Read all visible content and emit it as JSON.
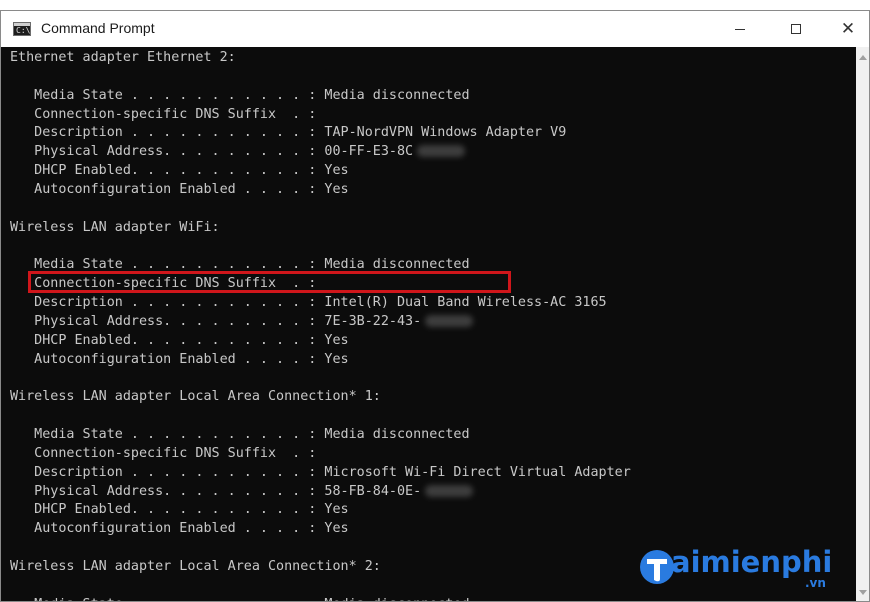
{
  "window": {
    "title": "Command Prompt",
    "icon": "cmd-icon",
    "icon_glyph": "C:\\",
    "controls": {
      "minimize": "minimize-icon",
      "maximize": "maximize-icon",
      "close": "close-icon",
      "close_glyph": "✕"
    }
  },
  "console": {
    "lines": [
      "Ethernet adapter Ethernet 2:",
      "",
      "   Media State . . . . . . . . . . . : Media disconnected",
      "   Connection-specific DNS Suffix  . :",
      "   Description . . . . . . . . . . . : TAP-NordVPN Windows Adapter V9",
      "   Physical Address. . . . . . . . . : 00-FF-E3-8C",
      "   DHCP Enabled. . . . . . . . . . . : Yes",
      "   Autoconfiguration Enabled . . . . : Yes",
      "",
      "Wireless LAN adapter WiFi:",
      "",
      "   Media State . . . . . . . . . . . : Media disconnected",
      "   Connection-specific DNS Suffix  . :",
      "   Description . . . . . . . . . . . : Intel(R) Dual Band Wireless-AC 3165",
      "   Physical Address. . . . . . . . . : 7E-3B-22-43-",
      "   DHCP Enabled. . . . . . . . . . . : Yes",
      "   Autoconfiguration Enabled . . . . : Yes",
      "",
      "Wireless LAN adapter Local Area Connection* 1:",
      "",
      "   Media State . . . . . . . . . . . : Media disconnected",
      "   Connection-specific DNS Suffix  . :",
      "   Description . . . . . . . . . . . : Microsoft Wi-Fi Direct Virtual Adapter",
      "   Physical Address. . . . . . . . . : 58-FB-84-0E-",
      "   DHCP Enabled. . . . . . . . . . . : Yes",
      "   Autoconfiguration Enabled . . . . : Yes",
      "",
      "Wireless LAN adapter Local Area Connection* 2:",
      "",
      "   Media State . . . . . . . . . . . : Media disconnected"
    ]
  },
  "watermark": {
    "text": "aimienphi",
    "suffix": ".vn",
    "logo_letter": "T"
  },
  "colors": {
    "console_bg": "#0c0c0c",
    "console_text": "#c8c8c8",
    "highlight": "#d0161b",
    "watermark": "#2a7be0"
  }
}
